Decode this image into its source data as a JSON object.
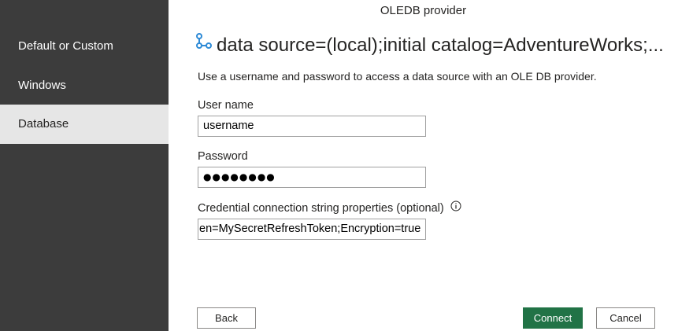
{
  "dialog": {
    "title": "OLEDB provider",
    "source_title": "data source=(local);initial catalog=AdventureWorks;...",
    "description": "Use a username and password to access a data source with an OLE DB provider."
  },
  "sidebar": {
    "items": [
      {
        "label": "Default or Custom",
        "selected": false
      },
      {
        "label": "Windows",
        "selected": false
      },
      {
        "label": "Database",
        "selected": true
      }
    ]
  },
  "form": {
    "username_label": "User name",
    "username_value": "username",
    "password_label": "Password",
    "password_value": "●●●●●●●●",
    "props_label": "Credential connection string properties (optional)",
    "props_value": "en=MySecretRefreshToken;Encryption=true"
  },
  "buttons": {
    "back": "Back",
    "connect": "Connect",
    "cancel": "Cancel"
  },
  "icons": {
    "source": "connection-icon",
    "info": "info-icon"
  },
  "colors": {
    "sidebar_bg": "#3c3c3c",
    "selected_item_bg": "#e6e6e6",
    "primary_button": "#217346",
    "connection_icon": "#2d8ad6"
  }
}
